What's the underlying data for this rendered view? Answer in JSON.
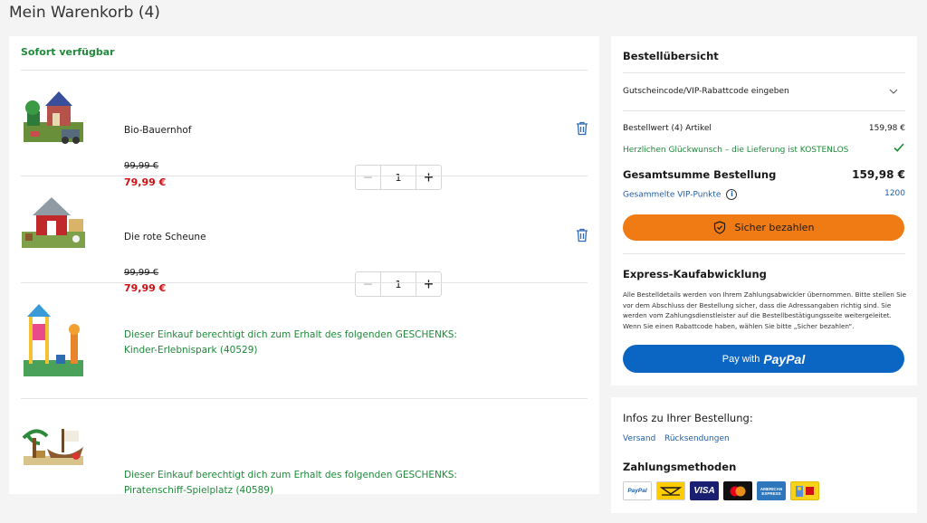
{
  "page": {
    "title": "Mein Warenkorb (4)"
  },
  "cart": {
    "availability": "Sofort verfügbar",
    "items": [
      {
        "name": "Bio-Bauernhof",
        "price_old": "99,99 €",
        "price_new": "79,99 €",
        "quantity": "1"
      },
      {
        "name": "Die rote Scheune",
        "price_old": "99,99 €",
        "price_new": "79,99 €",
        "quantity": "1"
      }
    ],
    "gifts": [
      {
        "line1": "Dieser Einkauf berechtigt dich zum Erhalt des folgenden GESCHENKS:",
        "line2": "Kinder-Erlebnispark (40529)"
      },
      {
        "line1": "Dieser Einkauf berechtigt dich zum Erhalt des folgenden GESCHENKS:",
        "line2": "Piratenschiff-Spielplatz (40589)"
      }
    ],
    "qty_minus": "−",
    "qty_plus": "+"
  },
  "summary": {
    "title": "Bestellübersicht",
    "coupon_label": "Gutscheincode/VIP-Rabattcode eingeben",
    "order_value_label": "Bestellwert (4) Artikel",
    "order_value": "159,98 €",
    "free_shipping": "Herzlichen Glückwunsch – die Lieferung ist KOSTENLOS",
    "total_label": "Gesamtsumme Bestellung",
    "total_value": "159,98 €",
    "vip_label": "Gesammelte VIP-Punkte",
    "vip_info": "i",
    "vip_points": "1200",
    "pay_button": "Sicher bezahlen",
    "express_title": "Express-Kaufabwicklung",
    "express_text": "Alle Bestelldetails werden von Ihrem Zahlungsabwickler übernommen. Bitte stellen Sie vor dem Abschluss der Bestellung sicher, dass die Adressangaben richtig sind. Sie werden vom Zahlungsdienstleister auf die Bestellbestätigungsseite weitergeleitet. Wenn Sie einen Rabattcode haben, wählen Sie bitte „Sicher bezahlen“.",
    "paypal_prefix": "Pay with",
    "paypal_logo": "PayPal",
    "colors": {
      "accent": "#f07b14",
      "paypal": "#0a66c2",
      "green": "#1f8a3a",
      "price_red": "#d01012",
      "link": "#1f5ea8"
    }
  },
  "info": {
    "title": "Infos zu Ihrer Bestellung:",
    "link_shipping": "Versand",
    "link_returns": "Rücksendungen",
    "payment_title": "Zahlungsmethoden",
    "methods": {
      "paypal": "PayPal",
      "visa": "VISA",
      "amex_line1": "AMERICAN",
      "amex_line2": "EXPRESS"
    }
  }
}
